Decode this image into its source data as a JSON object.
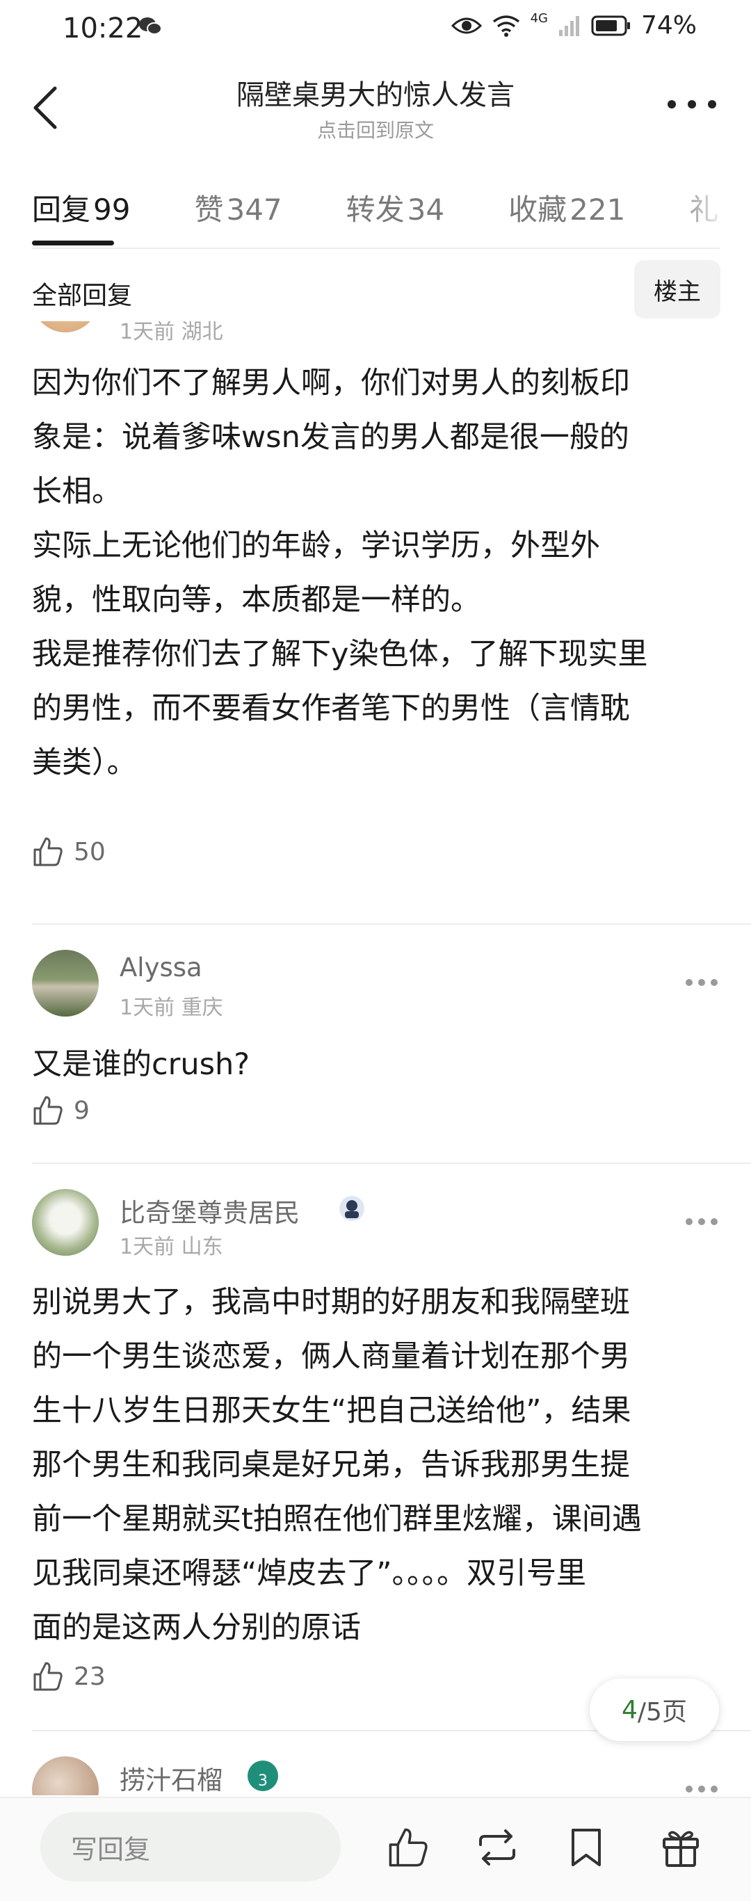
{
  "status_bar": {
    "time": "10:22",
    "network": "4G",
    "battery": "74%"
  },
  "nav": {
    "title": "隔壁桌男大的惊人发言",
    "subtitle": "点击回到原文"
  },
  "tabs": [
    {
      "label": "回复",
      "count": "99"
    },
    {
      "label": "赞",
      "count": "347"
    },
    {
      "label": "转发",
      "count": "34"
    },
    {
      "label": "收藏",
      "count": "221"
    },
    {
      "label": "礼",
      "count": ""
    }
  ],
  "filter": {
    "label": "全部回复",
    "owner_button": "楼主"
  },
  "comments": [
    {
      "meta": "1天前 湖北",
      "text": "因为你们不了解男人啊，你们对男人的刻板印\n象是：说着爹味wsn发言的男人都是很一般的\n长相。\n实际上无论他们的年龄，学识学历，外型外\n貌，性取向等，本质都是一样的。\n我是推荐你们去了解下y染色体，了解下现实里\n的男性，而不要看女作者笔下的男性（言情耽\n美类）。",
      "likes": "50"
    },
    {
      "name": "Alyssa",
      "meta": "1天前 重庆",
      "text": "又是谁的crush?",
      "likes": "9"
    },
    {
      "name": "比奇堡尊贵居民",
      "meta": "1天前 山东",
      "text": "别说男大了，我高中时期的好朋友和我隔壁班\n的一个男生谈恋爱，俩人商量着计划在那个男\n生十八岁生日那天女生“把自己送给他”，结果\n那个男生和我同桌是好兄弟，告诉我那男生提\n前一个星期就买t拍照在他们群里炫耀，课间遇\n见我同桌还嘚瑟“焯皮去了”。。。。双引号里\n面的是这两人分别的原话",
      "likes": "23"
    },
    {
      "name": "捞汁石榴",
      "badge": "3"
    }
  ],
  "pagination": {
    "current": "4",
    "total": "/5页"
  },
  "bottom_bar": {
    "reply_placeholder": "写回复"
  },
  "icons": [
    "back-icon",
    "more-icon",
    "like-icon",
    "repost-icon",
    "bookmark-icon",
    "gift-icon",
    "wifi-icon",
    "signal-icon",
    "battery-icon",
    "eye-icon",
    "wechat-icon"
  ],
  "colors": {
    "accent": "#2e7d32",
    "text": "#1a1a1a",
    "muted": "#a8a8a8"
  }
}
